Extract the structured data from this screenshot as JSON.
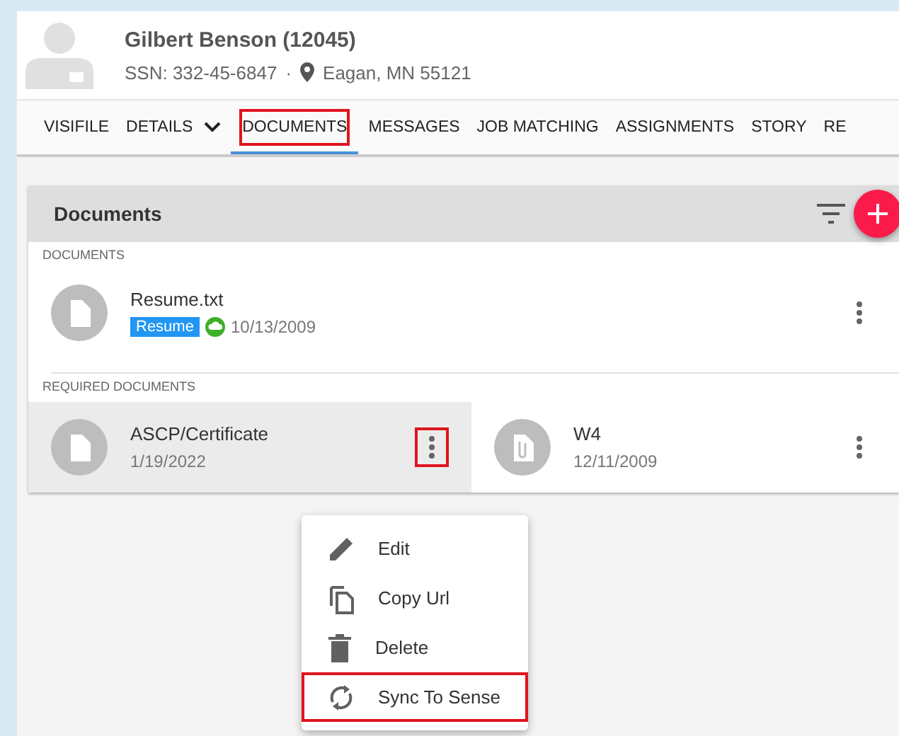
{
  "profile": {
    "name": "Gilbert Benson (12045)",
    "ssn": "SSN: 332-45-6847",
    "separator": "·",
    "location": "Eagan, MN 55121"
  },
  "tabs": [
    {
      "label": "VISIFILE",
      "selected": false,
      "highlighted": false
    },
    {
      "label": "DETAILS",
      "selected": false,
      "highlighted": false,
      "dropdown": true
    },
    {
      "label": "DOCUMENTS",
      "selected": true,
      "highlighted": true
    },
    {
      "label": "MESSAGES",
      "selected": false,
      "highlighted": false
    },
    {
      "label": "JOB MATCHING",
      "selected": false,
      "highlighted": false
    },
    {
      "label": "ASSIGNMENTS",
      "selected": false,
      "highlighted": false
    },
    {
      "label": "STORY",
      "selected": false,
      "highlighted": false
    },
    {
      "label": "RE",
      "selected": false,
      "highlighted": false
    }
  ],
  "panel": {
    "title": "Documents",
    "documents_heading": "DOCUMENTS",
    "documents": [
      {
        "name": "Resume.txt",
        "tag": "Resume",
        "synced": true,
        "date": "10/13/2009",
        "kind": "file"
      }
    ],
    "required_heading": "REQUIRED DOCUMENTS",
    "required": [
      {
        "name": "ASCP/Certificate",
        "date": "1/19/2022",
        "kind": "file",
        "selected": true,
        "menu_highlighted": true
      },
      {
        "name": "W4",
        "date": "12/11/2009",
        "kind": "attachment",
        "selected": false,
        "menu_highlighted": false
      }
    ]
  },
  "menu": [
    {
      "label": "Edit",
      "kind": "edit",
      "highlighted": false
    },
    {
      "label": "Copy Url",
      "kind": "copy",
      "highlighted": false
    },
    {
      "label": "Delete",
      "kind": "delete",
      "highlighted": false
    },
    {
      "label": "Sync To Sense",
      "kind": "sync",
      "highlighted": true
    }
  ]
}
